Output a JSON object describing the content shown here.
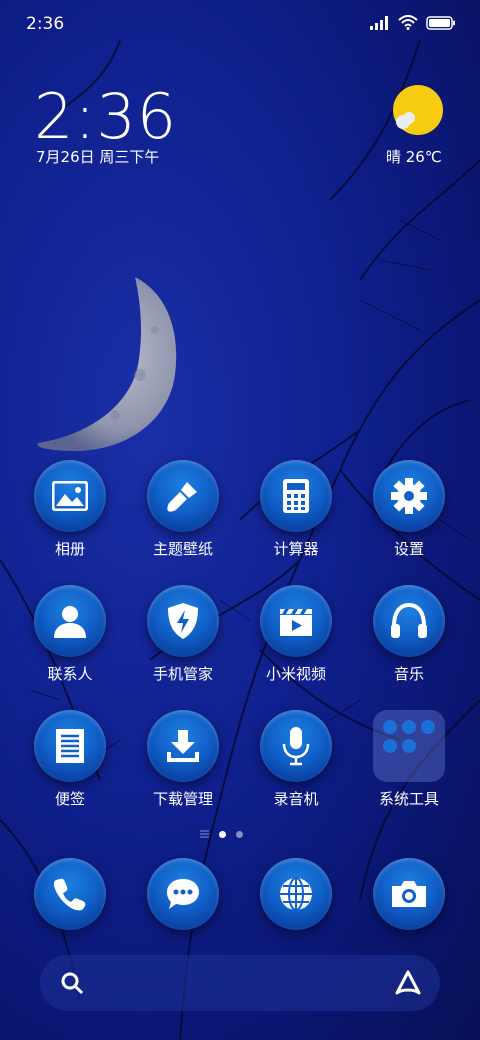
{
  "status": {
    "time": "2:36"
  },
  "lockwidget": {
    "clock": "2:36",
    "date": "7月26日 周三下午",
    "weather": "晴 26℃"
  },
  "apps": [
    {
      "label": "相册"
    },
    {
      "label": "主题壁纸"
    },
    {
      "label": "计算器"
    },
    {
      "label": "设置"
    },
    {
      "label": "联系人"
    },
    {
      "label": "手机管家"
    },
    {
      "label": "小米视频"
    },
    {
      "label": "音乐"
    },
    {
      "label": "便签"
    },
    {
      "label": "下载管理"
    },
    {
      "label": "录音机"
    },
    {
      "label": "系统工具"
    }
  ],
  "dock": [
    "phone-icon",
    "messages-icon",
    "browser-icon",
    "camera-icon"
  ],
  "colors": {
    "accent": "#1060c8",
    "sun": "#f7cc10",
    "background": "#0f1f8c"
  }
}
